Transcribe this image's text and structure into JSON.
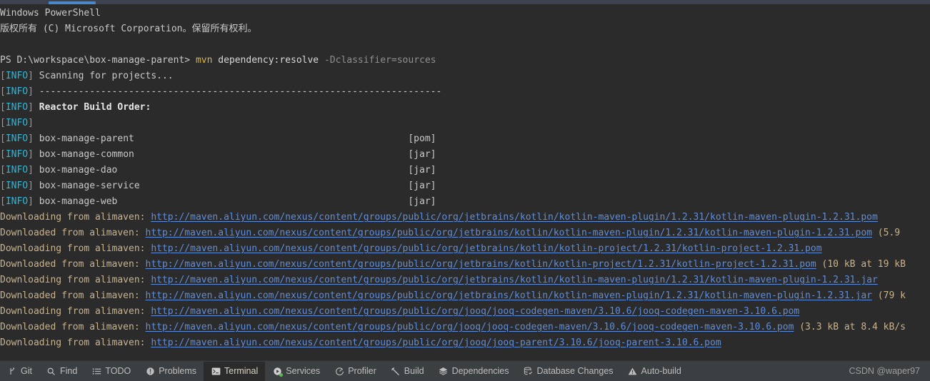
{
  "window": {
    "theme_bg": "#2b2b2b",
    "toolbar_bg": "#3c3f41",
    "accent": "#4a88c7",
    "link_color": "#5e8ddb",
    "info_color": "#29b8db"
  },
  "terminal": {
    "header_title": "Windows PowerShell",
    "copyright": "版权所有 (C) Microsoft Corporation。保留所有权利。",
    "prompt": "PS D:\\workspace\\box-manage-parent> ",
    "command_highlight": "mvn",
    "command_rest": " dependency:resolve",
    "command_args": " -Dclassifier=sources",
    "info_tag_open": "[",
    "info_tag_text": "INFO",
    "info_tag_close": "]",
    "scanning_line": " Scanning for projects...",
    "separator_line": " ------------------------------------------------------------------------",
    "reactor_title": " Reactor Build Order:",
    "empty_info": "",
    "modules": [
      {
        "name": " box-manage-parent",
        "packaging": "[pom]"
      },
      {
        "name": " box-manage-common",
        "packaging": "[jar]"
      },
      {
        "name": " box-manage-dao",
        "packaging": "[jar]"
      },
      {
        "name": " box-manage-service",
        "packaging": "[jar]"
      },
      {
        "name": " box-manage-web",
        "packaging": "[jar]"
      }
    ],
    "downloads": [
      {
        "prefix": "Downloading from alimaven: ",
        "url": "http://maven.aliyun.com/nexus/content/groups/public/org/jetbrains/kotlin/kotlin-maven-plugin/1.2.31/kotlin-maven-plugin-1.2.31.pom",
        "suffix": ""
      },
      {
        "prefix": "Downloaded from alimaven: ",
        "url": "http://maven.aliyun.com/nexus/content/groups/public/org/jetbrains/kotlin/kotlin-maven-plugin/1.2.31/kotlin-maven-plugin-1.2.31.pom",
        "suffix": " (5.9"
      },
      {
        "prefix": "Downloading from alimaven: ",
        "url": "http://maven.aliyun.com/nexus/content/groups/public/org/jetbrains/kotlin/kotlin-project/1.2.31/kotlin-project-1.2.31.pom",
        "suffix": ""
      },
      {
        "prefix": "Downloaded from alimaven: ",
        "url": "http://maven.aliyun.com/nexus/content/groups/public/org/jetbrains/kotlin/kotlin-project/1.2.31/kotlin-project-1.2.31.pom",
        "suffix": " (10 kB at 19 kB"
      },
      {
        "prefix": "Downloading from alimaven: ",
        "url": "http://maven.aliyun.com/nexus/content/groups/public/org/jetbrains/kotlin/kotlin-maven-plugin/1.2.31/kotlin-maven-plugin-1.2.31.jar",
        "suffix": ""
      },
      {
        "prefix": "Downloaded from alimaven: ",
        "url": "http://maven.aliyun.com/nexus/content/groups/public/org/jetbrains/kotlin/kotlin-maven-plugin/1.2.31/kotlin-maven-plugin-1.2.31.jar",
        "suffix": " (79 k"
      },
      {
        "prefix": "Downloading from alimaven: ",
        "url": "http://maven.aliyun.com/nexus/content/groups/public/org/jooq/jooq-codegen-maven/3.10.6/jooq-codegen-maven-3.10.6.pom",
        "suffix": ""
      },
      {
        "prefix": "Downloaded from alimaven: ",
        "url": "http://maven.aliyun.com/nexus/content/groups/public/org/jooq/jooq-codegen-maven/3.10.6/jooq-codegen-maven-3.10.6.pom",
        "suffix": " (3.3 kB at 8.4 kB/s"
      },
      {
        "prefix": "Downloading from alimaven: ",
        "url": "http://maven.aliyun.com/nexus/content/groups/public/org/jooq/jooq-parent/3.10.6/jooq-parent-3.10.6.pom",
        "suffix": ""
      }
    ]
  },
  "toolbar": {
    "buttons": [
      {
        "label": "Git",
        "icon": "git-branch-icon",
        "active": false
      },
      {
        "label": "Find",
        "icon": "magnifier-icon",
        "active": false
      },
      {
        "label": "TODO",
        "icon": "list-icon",
        "active": false
      },
      {
        "label": "Problems",
        "icon": "exclamation-circle-icon",
        "active": false
      },
      {
        "label": "Terminal",
        "icon": "terminal-icon",
        "active": true
      },
      {
        "label": "Services",
        "icon": "play-circle-icon",
        "active": false
      },
      {
        "label": "Profiler",
        "icon": "profiler-icon",
        "active": false
      },
      {
        "label": "Build",
        "icon": "hammer-icon",
        "active": false
      },
      {
        "label": "Dependencies",
        "icon": "layers-icon",
        "active": false
      },
      {
        "label": "Database Changes",
        "icon": "database-check-icon",
        "active": false
      },
      {
        "label": "Auto-build",
        "icon": "warning-triangle-icon",
        "active": false
      }
    ],
    "watermark": "CSDN @waper97"
  }
}
